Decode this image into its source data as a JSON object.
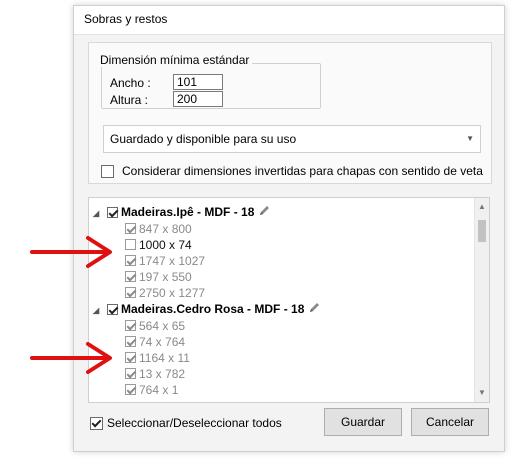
{
  "window": {
    "title": "Sobras y restos"
  },
  "dimension_group": {
    "legend": "Dimensión mínima estándar",
    "width_label": "Ancho :",
    "width_value": "101",
    "height_label": "Altura :",
    "height_value": "200"
  },
  "status_select": {
    "value": "Guardado y disponible para su uso"
  },
  "consider_inverted": {
    "label": "Considerar dimensiones invertidas para chapas con sentido de veta",
    "checked": false
  },
  "tree": {
    "groups": [
      {
        "label": "Madeiras.Ipê - MDF - 18",
        "checked": true,
        "items": [
          {
            "label": "847 x 800",
            "checked": true
          },
          {
            "label": "1000 x 74",
            "checked": false
          },
          {
            "label": "1747 x 1027",
            "checked": true
          },
          {
            "label": "197 x 550",
            "checked": true
          },
          {
            "label": "2750 x 1277",
            "checked": true
          }
        ]
      },
      {
        "label": "Madeiras.Cedro Rosa - MDF - 18",
        "checked": true,
        "items": [
          {
            "label": "564 x 65",
            "checked": true
          },
          {
            "label": "74 x 764",
            "checked": true
          },
          {
            "label": "1164 x 11",
            "checked": true
          },
          {
            "label": "13 x 782",
            "checked": true
          },
          {
            "label": "764 x 1",
            "checked": true
          }
        ]
      }
    ]
  },
  "footer": {
    "select_all_label": "Seleccionar/Deseleccionar todos",
    "select_all_checked": true,
    "save_label": "Guardar",
    "cancel_label": "Cancelar"
  },
  "colors": {
    "annotation_arrow": "#e01010"
  },
  "icons": {
    "edit": "pencil-icon",
    "expander": "triangle-down-icon"
  }
}
